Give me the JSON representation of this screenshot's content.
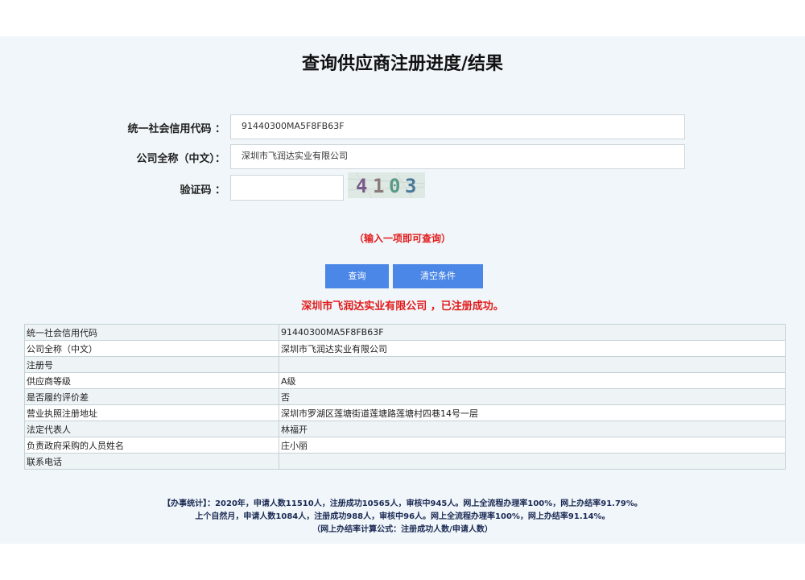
{
  "page": {
    "title": "查询供应商注册进度/结果"
  },
  "form": {
    "credit_code_label": "统一社会信用代码 ：",
    "credit_code_value": "91440300MA5F8FB63F",
    "company_name_label": "公司全称（中文）：",
    "company_name_value": "深圳市飞润达实业有限公司",
    "captcha_label": "验证码 ：",
    "captcha_value": "",
    "captcha_text": "4103",
    "hint": "（输入一项即可查询）",
    "query_button": "查询",
    "clear_button": "清空条件"
  },
  "result": {
    "message": "深圳市飞润达实业有限公司 ，已注册成功。",
    "rows": [
      {
        "label": "统一社会信用代码",
        "value": "91440300MA5F8FB63F"
      },
      {
        "label": "公司全称（中文）",
        "value": "深圳市飞润达实业有限公司"
      },
      {
        "label": "注册号",
        "value": ""
      },
      {
        "label": "供应商等级",
        "value": "A级"
      },
      {
        "label": "是否履约评价差",
        "value": "否"
      },
      {
        "label": "营业执照注册地址",
        "value": "深圳市罗湖区莲塘街道莲塘路莲塘村四巷14号一层"
      },
      {
        "label": "法定代表人",
        "value": "林福开"
      },
      {
        "label": "负责政府采购的人员姓名",
        "value": "庄小丽"
      },
      {
        "label": "联系电话",
        "value": ""
      }
    ]
  },
  "stats": {
    "line1": "【办事统计】：2020年，申请人数11510人，注册成功10565人，审核中945人。网上全流程办理率100%，网上办结率91.79%。",
    "line2": "上个自然月，申请人数1084人，注册成功988人，审核中96人。网上全流程办理率100%，网上办结率91.14%。",
    "line3": "（网上办结率计算公式：注册成功人数/申请人数）"
  }
}
